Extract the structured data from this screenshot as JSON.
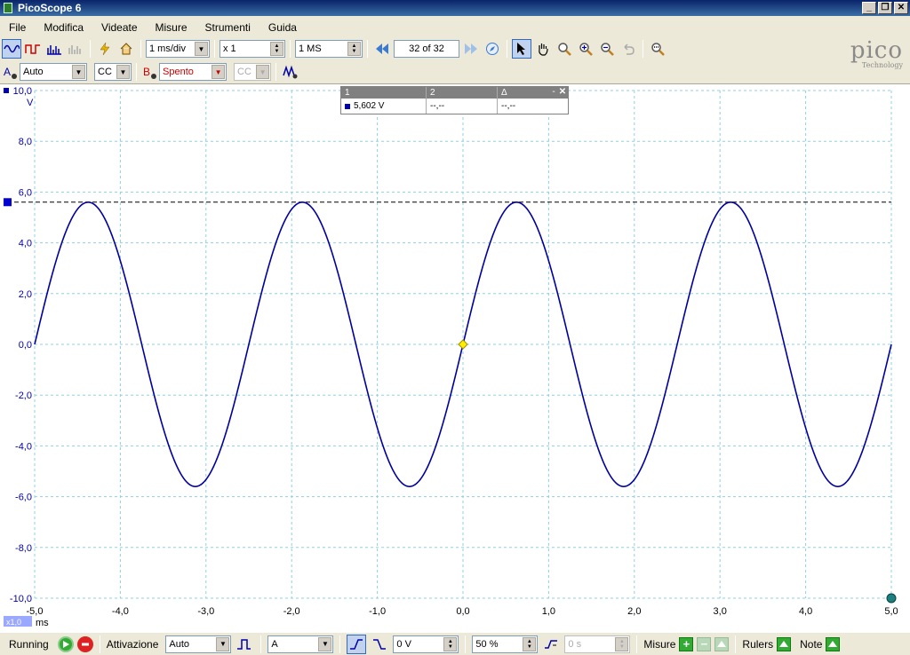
{
  "window": {
    "title": "PicoScope 6"
  },
  "menu": [
    "File",
    "Modifica",
    "Videate",
    "Misure",
    "Strumenti",
    "Guida"
  ],
  "toolbar1": {
    "timebase": "1 ms/div",
    "zoom": "x 1",
    "samples": "1 MS",
    "buffer": "32 of 32"
  },
  "toolbar2": {
    "chanA_label": "A",
    "chanA_range": "Auto",
    "chanA_coupling": "CC",
    "chanB_label": "B",
    "chanB_range": "Spento",
    "chanB_coupling": "CC"
  },
  "logo": {
    "brand": "pico",
    "sub": "Technology"
  },
  "measurements_table": {
    "headers": [
      "1",
      "2",
      "Δ"
    ],
    "values": [
      "5,602 V",
      "--,--",
      "--,--"
    ]
  },
  "chart_data": {
    "type": "line",
    "title": "",
    "xlabel": "ms",
    "ylabel": "V",
    "xlim": [
      -5.0,
      5.0
    ],
    "ylim": [
      -10.0,
      10.0
    ],
    "x_ticks": [
      "-5,0",
      "-4,0",
      "-3,0",
      "-2,0",
      "-1,0",
      "0,0",
      "1,0",
      "2,0",
      "3,0",
      "4,0",
      "5,0"
    ],
    "y_ticks": [
      "10,0",
      "8,0",
      "6,0",
      "4,0",
      "2,0",
      "0,0",
      "-2,0",
      "-4,0",
      "-6,0",
      "-8,0",
      "-10,0"
    ],
    "y_unit_label": "V",
    "x_zoom_badge": "x1,0",
    "grid": true,
    "series": [
      {
        "amplitude": 5.6,
        "period_ms": 2.5,
        "phase_zero_at_ms": 0.0,
        "color": "#0000a0"
      }
    ],
    "ruler_value_v": 5.602,
    "trigger_point": {
      "x": 0.0,
      "y": 0.0
    }
  },
  "status": {
    "state": "Running",
    "trigger_label": "Attivazione",
    "trigger_mode": "Auto",
    "trigger_source": "A",
    "trigger_level": "0 V",
    "pretrigger": "50 %",
    "delay": "0 s",
    "measure_label": "Misure",
    "rulers_label": "Rulers",
    "notes_label": "Note"
  },
  "colors": {
    "trace": "#0000a0",
    "grid": "#8fd0e0",
    "ruler": "#000000"
  }
}
